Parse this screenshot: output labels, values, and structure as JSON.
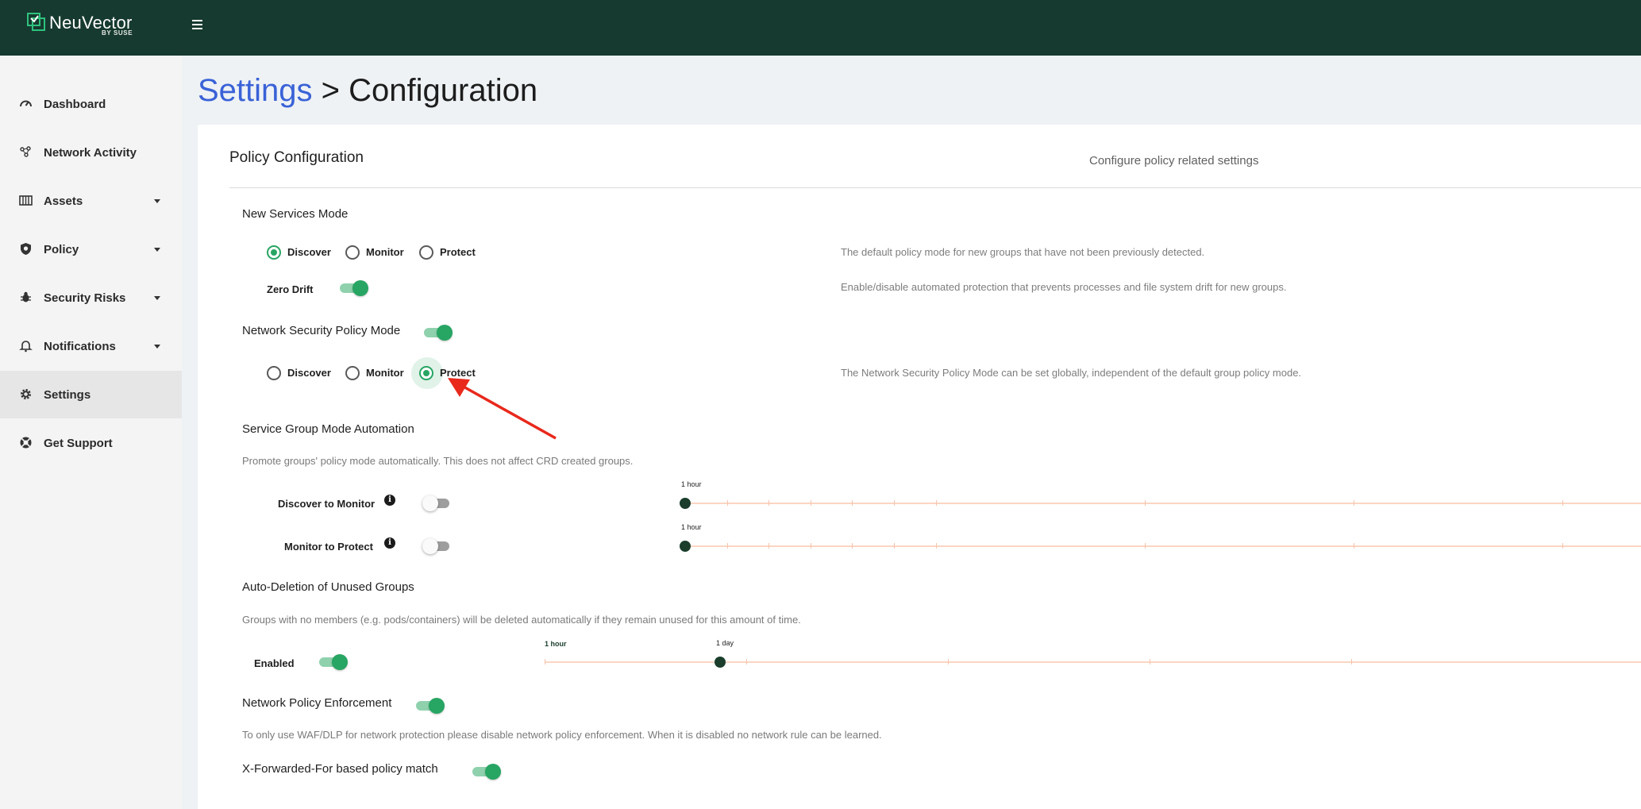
{
  "app": {
    "brand": "NeuVector",
    "brand_sub": "BY SUSE"
  },
  "sidebar": {
    "items": [
      {
        "label": "Dashboard",
        "icon": "dashboard-gauge-icon",
        "expandable": false,
        "active": false
      },
      {
        "label": "Network Activity",
        "icon": "network-activity-icon",
        "expandable": false,
        "active": false
      },
      {
        "label": "Assets",
        "icon": "assets-icon",
        "expandable": true,
        "active": false
      },
      {
        "label": "Policy",
        "icon": "shield-icon",
        "expandable": true,
        "active": false
      },
      {
        "label": "Security Risks",
        "icon": "bug-icon",
        "expandable": true,
        "active": false
      },
      {
        "label": "Notifications",
        "icon": "bell-icon",
        "expandable": true,
        "active": false
      },
      {
        "label": "Settings",
        "icon": "gear-icon",
        "expandable": false,
        "active": true
      },
      {
        "label": "Get Support",
        "icon": "lifebuoy-icon",
        "expandable": false,
        "active": false
      }
    ]
  },
  "header": {
    "breadcrumb": "Settings",
    "separator": ">",
    "title": "Configuration"
  },
  "card": {
    "title": "Policy Configuration",
    "description": "Configure policy related settings"
  },
  "new_services_mode": {
    "title": "New Services Mode",
    "options": [
      "Discover",
      "Monitor",
      "Protect"
    ],
    "selected": "Discover",
    "description": "The default policy mode for new groups that have not been previously detected."
  },
  "zero_drift": {
    "label": "Zero Drift",
    "enabled": true,
    "description": "Enable/disable automated protection that prevents processes and file system drift for new groups."
  },
  "network_security_policy_mode": {
    "title": "Network Security Policy Mode",
    "enabled": true,
    "options": [
      "Discover",
      "Monitor",
      "Protect"
    ],
    "selected": "Protect",
    "description": "The Network Security Policy Mode can be set globally, independent of the default group policy mode."
  },
  "service_group_mode_automation": {
    "title": "Service Group Mode Automation",
    "help": "Promote groups' policy mode automatically. This does not affect CRD created groups.",
    "rows": [
      {
        "label": "Discover to Monitor",
        "enabled": false,
        "value_label": "1 hour",
        "value_fraction": 0
      },
      {
        "label": "Monitor to Protect",
        "enabled": false,
        "value_label": "1 hour",
        "value_fraction": 0
      }
    ]
  },
  "auto_deletion": {
    "title": "Auto-Deletion of Unused Groups",
    "help": "Groups with no members (e.g. pods/containers) will be deleted automatically if they remain unused for this amount of time.",
    "label": "Enabled",
    "enabled": true,
    "min_label": "1 hour",
    "value_label": "1 day",
    "value_fraction": 0.16
  },
  "network_policy_enforcement": {
    "title": "Network Policy Enforcement",
    "enabled": true,
    "help": "To only use WAF/DLP for network protection please disable network policy enforcement. When it is disabled no network rule can be learned."
  },
  "x_forwarded_for": {
    "title": "X-Forwarded-For based policy match",
    "enabled": true
  },
  "colors": {
    "topbar": "#163a2f",
    "accent_green": "#27a563",
    "link_blue": "#3a62d7",
    "slider_rail": "#fbd5c3",
    "slider_thumb": "#1a3d2c",
    "annotation_arrow": "#e8291c"
  }
}
